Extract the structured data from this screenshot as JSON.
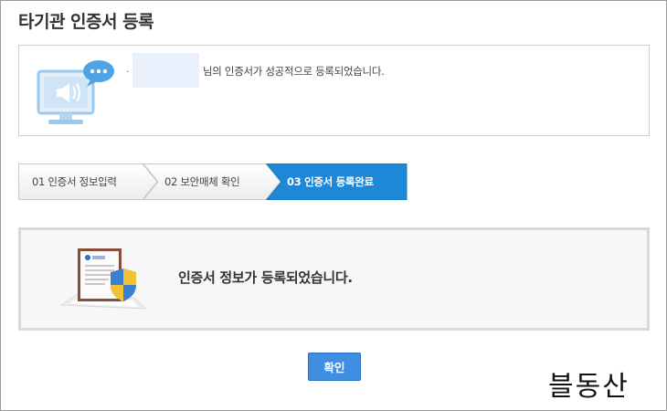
{
  "page": {
    "title": "타기관 인증서 등록"
  },
  "info": {
    "bullet": "·",
    "message": "님의 인증서가 성공적으로 등록되었습니다."
  },
  "steps": [
    {
      "label": "01 인증서 정보입력",
      "active": false
    },
    {
      "label": "02 보안매체 확인",
      "active": false
    },
    {
      "label": "03 인증서 등록완료",
      "active": true
    }
  ],
  "result": {
    "message": "인증서 정보가 등록되었습니다."
  },
  "confirm_button": {
    "label": "확인"
  },
  "watermark": {
    "text": "블동산"
  },
  "colors": {
    "accent": "#3f8ee2",
    "active_step": "#1e88d8",
    "border": "#cfcfcf",
    "result_background": "#f7f7f7"
  },
  "icons": {
    "monitor": "monitor-speech-bubble-icon",
    "certificate": "certificate-shield-icon"
  }
}
